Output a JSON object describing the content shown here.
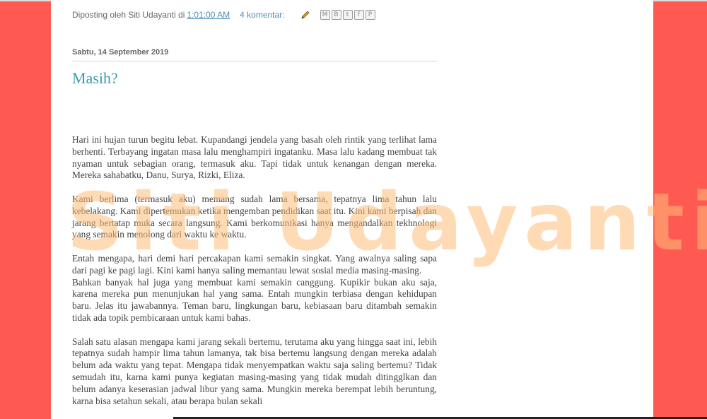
{
  "post_footer": {
    "posted_by": "Diposting oleh Siti Udayanti di",
    "time": "1:01:00 AM",
    "comments": "4 komentar:",
    "share_icons": [
      "email-icon",
      "blogger-icon",
      "twitter-icon",
      "facebook-icon",
      "pinterest-icon"
    ],
    "share_glyphs": [
      "M",
      "B",
      "t",
      "f",
      "P"
    ]
  },
  "date_header": "Sabtu, 14 September 2019",
  "post_title": "Masih?",
  "paragraphs": [
    "Hari ini hujan turun begitu lebat. Kupandangi jendela yang basah oleh rintik yang terlihat lama berhenti. Terbayang ingatan masa lalu menghampiri ingatanku. Masa lalu kadang membuat tak nyaman untuk sebagian orang, termasuk aku. Tapi tidak untuk kenangan dengan mereka. Mereka sahabatku, Danu, Surya, Rizki, Eliza.",
    "Kami berlima (termasuk aku) memang sudah lama bersama, tepatnya lima tahun lalu kebelakang. Kami dipertemukan ketika mengemban pendidikan saat itu. Kini kami berpisah dan jarang bertatap muka secara langsung. Kami berkomunikasi hanya mengandalkan tekhnologi yang semakin menolong dari waktu ke waktu.",
    "Entah mengapa, hari demi hari percakapan kami semakin singkat. Yang awalnya saling sapa dari pagi ke pagi lagi. Kini kami hanya saling memantau lewat sosial media masing-masing.",
    "Bahkan banyak hal juga yang membuat kami semakin canggung. Kupikir bukan aku saja, karena mereka pun menunjukan hal yang sama. Entah mungkin terbiasa dengan kehidupan baru. Jelas itu jawabannya. Teman baru, lingkungan baru, kebiasaan baru ditambah semakin tidak ada topik pembicaraan untuk kami bahas.",
    "Salah satu alasan mengapa kami jarang sekali bertemu, terutama aku yang hingga saat ini, lebih tepatnya sudah hampir lima tahun lamanya, tak bisa bertemu langsung dengan mereka adalah belum ada waktu yang tepat. Mengapa tidak menyempatkan waktu saja saling bertemu? Tidak semudah itu, karna kami punya kegiatan masing-masing yang tidak mudah ditingglkan dan belum adanya keserasian jadwal libur yang sama. Mungkin mereka berempat lebih beruntung, karna bisa setahun sekali, atau berapa bulan sekali"
  ],
  "watermark": "Siti Udayanti"
}
